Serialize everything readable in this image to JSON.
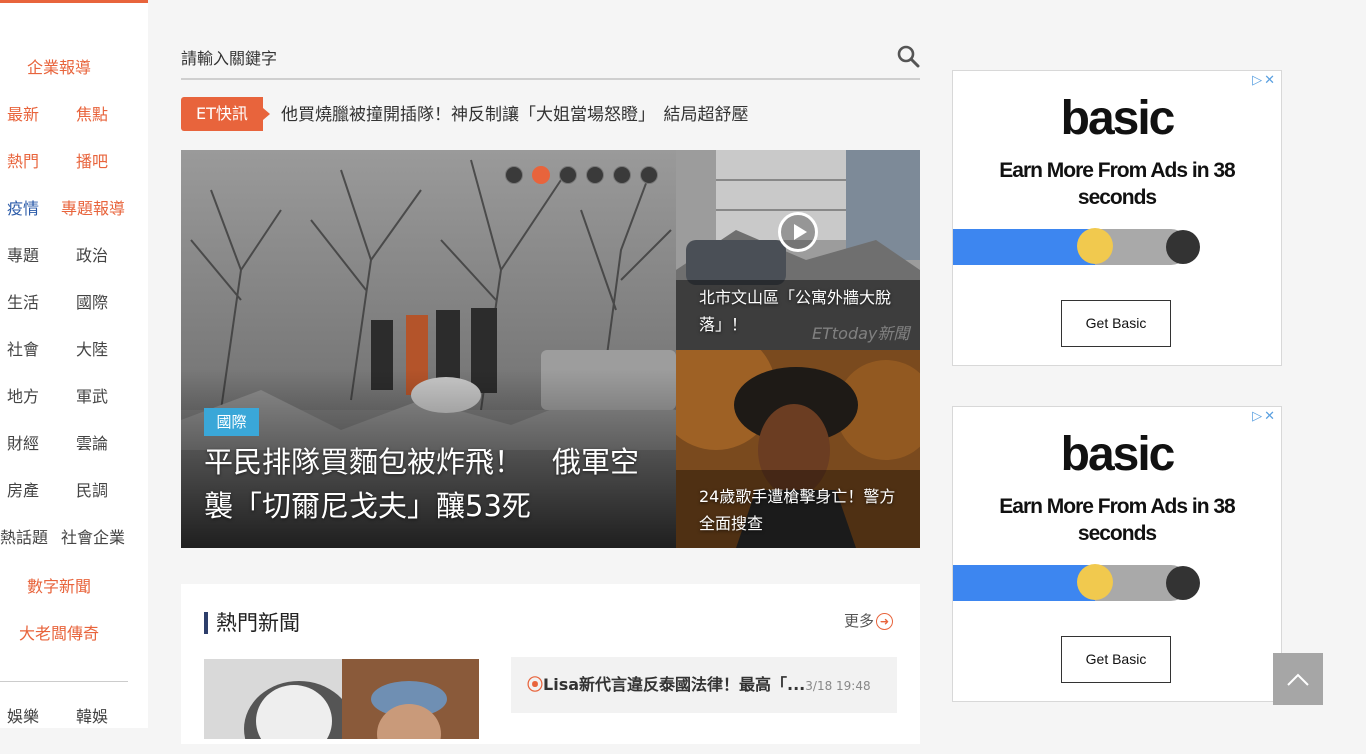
{
  "sidebar": {
    "top_item": "企業報導",
    "rows": [
      {
        "left": "最新",
        "right": "焦點",
        "left_color": "orange",
        "right_color": "orange"
      },
      {
        "left": "熱門",
        "right": "播吧",
        "left_color": "orange",
        "right_color": "orange"
      },
      {
        "left": "疫情",
        "right": "專題報導",
        "left_color": "blue",
        "right_color": "orange"
      },
      {
        "left": "專題",
        "right": "政治",
        "left_color": "dark",
        "right_color": "dark"
      },
      {
        "left": "生活",
        "right": "國際",
        "left_color": "dark",
        "right_color": "dark"
      },
      {
        "left": "社會",
        "right": "大陸",
        "left_color": "dark",
        "right_color": "dark"
      },
      {
        "left": "地方",
        "right": "軍武",
        "left_color": "dark",
        "right_color": "dark"
      },
      {
        "left": "財經",
        "right": "雲論",
        "left_color": "dark",
        "right_color": "dark"
      },
      {
        "left": "房產",
        "right": "民調",
        "left_color": "dark",
        "right_color": "dark"
      },
      {
        "left": "熱話題",
        "right": "社會企業",
        "left_color": "dark",
        "right_color": "dark"
      }
    ],
    "digital_news": "數字新聞",
    "boss_legend": "大老闆傳奇",
    "bottom_row": {
      "left": "娛樂",
      "right": "韓娛"
    }
  },
  "search": {
    "placeholder": "請輸入關鍵字"
  },
  "flash": {
    "tag": "ET快訊",
    "headline": "他買燒臘被撞開插隊！神反制讓「大姐當場怒瞪」　結局超舒壓"
  },
  "hero": {
    "category": "國際",
    "title": "平民排隊買麵包被炸飛！　俄軍空襲「切爾尼戈夫」釀53死",
    "dots_count": 6,
    "active_dot": 2,
    "side_top_caption": "北市文山區「公寓外牆大脫落」！",
    "side_top_watermark": "ETtoday新聞",
    "side_bottom_caption": "24歲歌手遭槍擊身亡！警方全面搜查"
  },
  "hot_news": {
    "title": "熱門新聞",
    "more": "更多",
    "item_headline": "Lisa新代言違反泰國法律！最高「...",
    "item_time": "3/18 19:48"
  },
  "ads": [
    {
      "brand": "basic",
      "headline": "Earn More From Ads in 38 seconds",
      "button": "Get Basic",
      "progress": 0.6
    },
    {
      "brand": "basic",
      "headline": "Earn More From Ads in 38 seconds",
      "button": "Get Basic",
      "progress": 0.6
    }
  ],
  "colors": {
    "accent": "#e8643c",
    "tag_blue": "#3aa7d8",
    "nav_blue": "#2a5aa8"
  }
}
